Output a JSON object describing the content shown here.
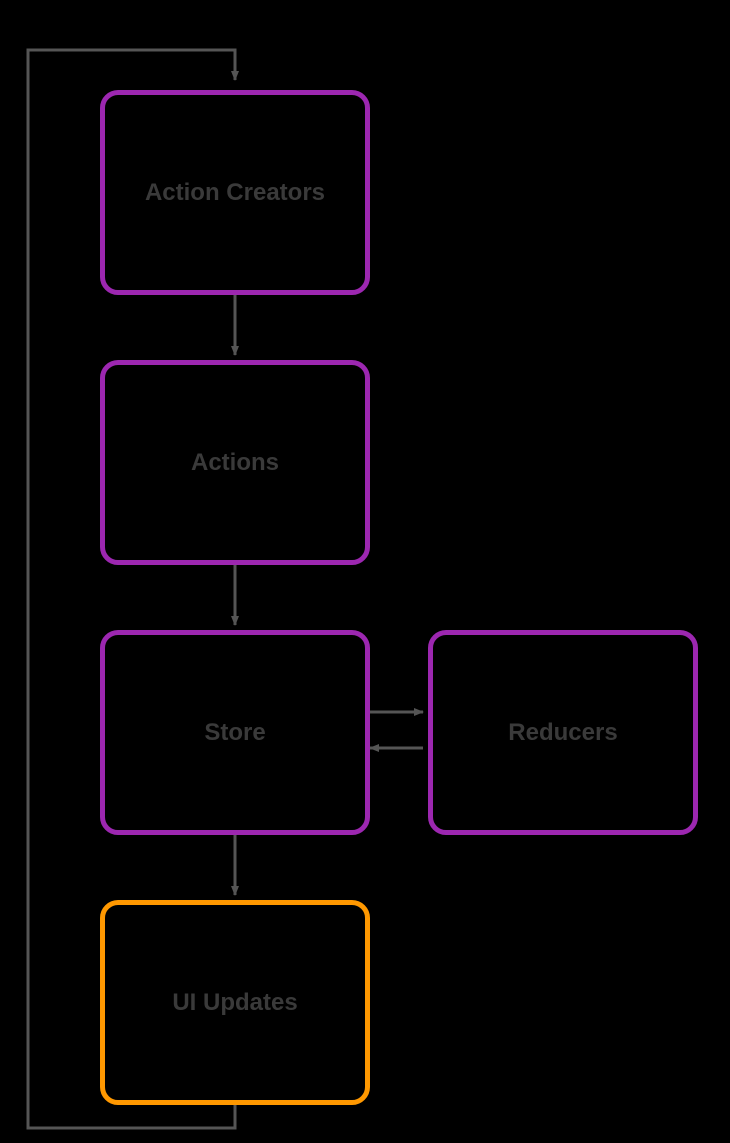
{
  "diagram": {
    "type": "flowchart",
    "nodes": {
      "action_creators": {
        "label": "Action Creators",
        "color": "purple"
      },
      "actions": {
        "label": "Actions",
        "color": "purple"
      },
      "store": {
        "label": "Store",
        "color": "purple"
      },
      "reducers": {
        "label": "Reducers",
        "color": "purple"
      },
      "ui_updates": {
        "label": "UI Updates",
        "color": "orange"
      }
    },
    "edges": [
      {
        "from": "action_creators",
        "to": "actions"
      },
      {
        "from": "actions",
        "to": "store"
      },
      {
        "from": "store",
        "to": "reducers",
        "bidirectional": true
      },
      {
        "from": "store",
        "to": "ui_updates"
      },
      {
        "from": "ui_updates",
        "to": "action_creators",
        "feedback_loop": true
      }
    ],
    "colors": {
      "purple": "#9C27B0",
      "orange": "#FF9800",
      "arrow": "#555555"
    }
  }
}
